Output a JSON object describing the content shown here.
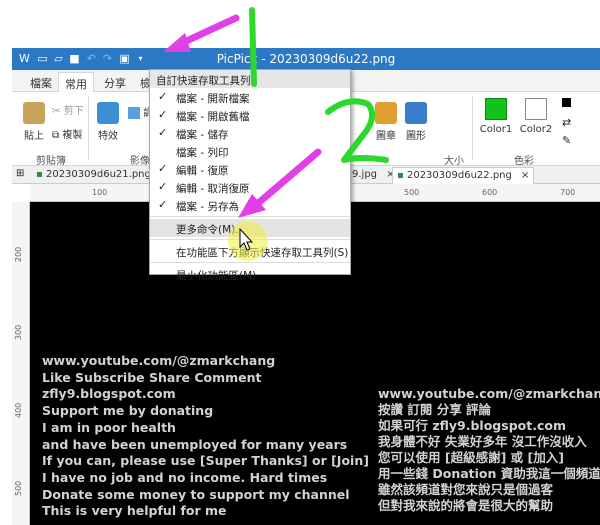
{
  "window": {
    "title": "PicPick - 20230309d6u22.png"
  },
  "ribbon_tabs": [
    "檔案",
    "常用",
    "分享",
    "檢"
  ],
  "ribbon": {
    "paste": "貼上",
    "cut": "剪下",
    "copy": "複製",
    "clipboard_group": "剪貼簿",
    "special": "特效",
    "adjust": "調",
    "image_group": "影像",
    "shape": "圖章",
    "form": "圖形",
    "size_group": "大小",
    "color1": "Color1",
    "color2": "Color2",
    "color_group": "色彩",
    "colors": {
      "color1": "#10c21b",
      "color2": "#ffffff"
    }
  },
  "doc_tabs": [
    "20230309d6u21.png",
    "9.jpg",
    "20230309d6u22.png"
  ],
  "rulers": {
    "h": [
      "100",
      "200",
      "300",
      "400",
      "500",
      "600",
      "700"
    ],
    "v": [
      "200",
      "300",
      "400",
      "500"
    ]
  },
  "menu": {
    "header": "自訂快速存取工具列",
    "items": [
      {
        "label": "檔案 - 開新檔案",
        "checked": true
      },
      {
        "label": "檔案 - 開啟舊檔",
        "checked": true
      },
      {
        "label": "檔案 - 儲存",
        "checked": true
      },
      {
        "label": "檔案 - 列印",
        "checked": false
      },
      {
        "label": "編輯 - 復原",
        "checked": true
      },
      {
        "label": "編輯 - 取消復原",
        "checked": true
      },
      {
        "label": "檔案 - 另存為",
        "checked": true
      }
    ],
    "more": "更多命令(M)...",
    "below": "在功能區下方顯示快速存取工具列(S)",
    "minimize": "最小化功能區(M)"
  },
  "annotations": {
    "mark1": "1",
    "mark2": "2"
  },
  "overlay_left": [
    "www.youtube.com/@zmarkchang",
    "Like Subscribe Share Comment",
    "zfly9.blogspot.com",
    "Support me by donating",
    "I am in poor health",
    "and have been unemployed for many years",
    "If you can, please use [Super Thanks] or [Join]",
    "I have no job and no income. Hard times",
    "Donate some money to support my channel",
    "This is very helpful for me"
  ],
  "overlay_right": [
    "www.youtube.com/@zmarkchang",
    "按讚 訂閱 分享 評論",
    "如果可行 zfly9.blogspot.com",
    "我身體不好 失業好多年 沒工作沒收入",
    "您可以使用 [超級感謝] 或 [加入]",
    "用一些錢 Donation 資助我這一個頻道",
    "雖然該頻道對您來說只是個過客",
    "但對我來說的將會是很大的幫助"
  ]
}
